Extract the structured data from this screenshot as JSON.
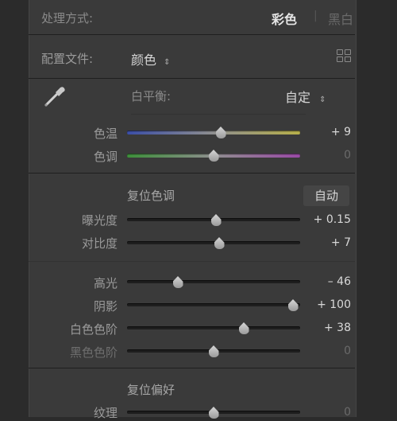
{
  "treatment": {
    "label": "处理方式:",
    "color": "彩色",
    "bw": "黑白"
  },
  "profile": {
    "label": "配置文件:",
    "value": "颜色",
    "browse_icon": "grid-icon"
  },
  "white_balance": {
    "label": "白平衡:",
    "value": "自定"
  },
  "sliders_wb": [
    {
      "label": "色温",
      "value": "+ 9"
    },
    {
      "label": "色调",
      "value": "0"
    }
  ],
  "tone": {
    "reset_label": "复位色调",
    "auto_label": "自动"
  },
  "sliders_tone": [
    {
      "label": "曝光度",
      "value": "+ 0.15"
    },
    {
      "label": "对比度",
      "value": "+ 7"
    }
  ],
  "sliders_tonal": [
    {
      "label": "高光",
      "value": "– 46"
    },
    {
      "label": "阴影",
      "value": "+ 100"
    },
    {
      "label": "白色色阶",
      "value": "+ 38"
    },
    {
      "label": "黑色色阶",
      "value": "0"
    }
  ],
  "presence": {
    "reset_label": "复位偏好"
  },
  "sliders_presence": [
    {
      "label": "纹理",
      "value": "0"
    }
  ]
}
